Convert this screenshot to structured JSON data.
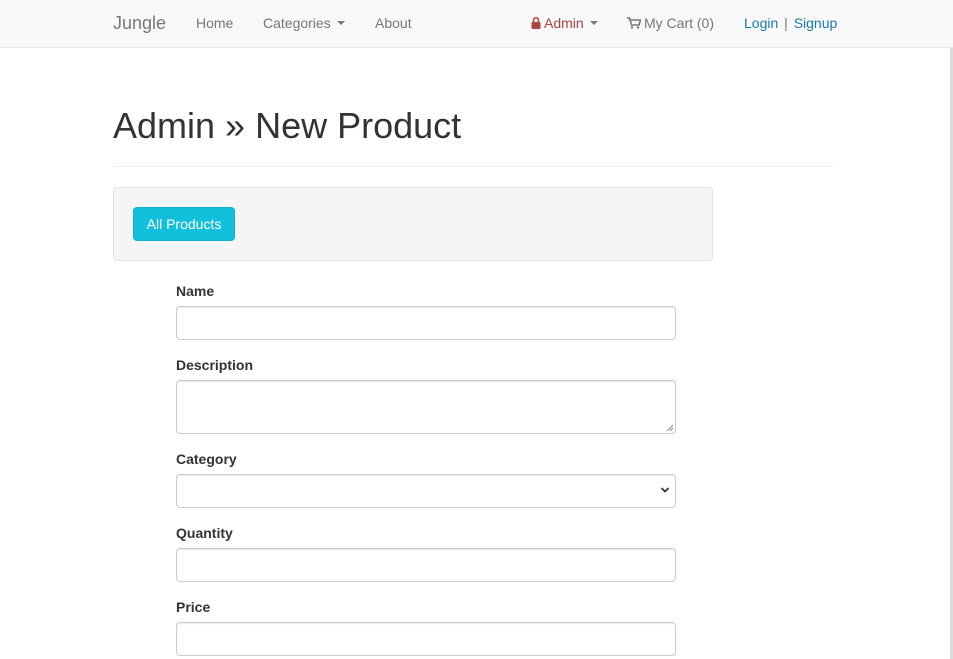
{
  "navbar": {
    "brand": "Jungle",
    "home": "Home",
    "categories": "Categories",
    "about": "About",
    "admin": "Admin",
    "cart": "My Cart (0)",
    "login": "Login",
    "separator": "|",
    "signup": "Signup"
  },
  "page": {
    "title": "Admin » New Product",
    "all_products_button": "All Products"
  },
  "form": {
    "name": {
      "label": "Name",
      "value": ""
    },
    "description": {
      "label": "Description",
      "value": ""
    },
    "category": {
      "label": "Category",
      "selected": ""
    },
    "quantity": {
      "label": "Quantity",
      "value": ""
    },
    "price": {
      "label": "Price",
      "value": ""
    }
  },
  "colors": {
    "admin": "#a94442",
    "link": "#1a7ab3",
    "button": "#13c0dc"
  }
}
